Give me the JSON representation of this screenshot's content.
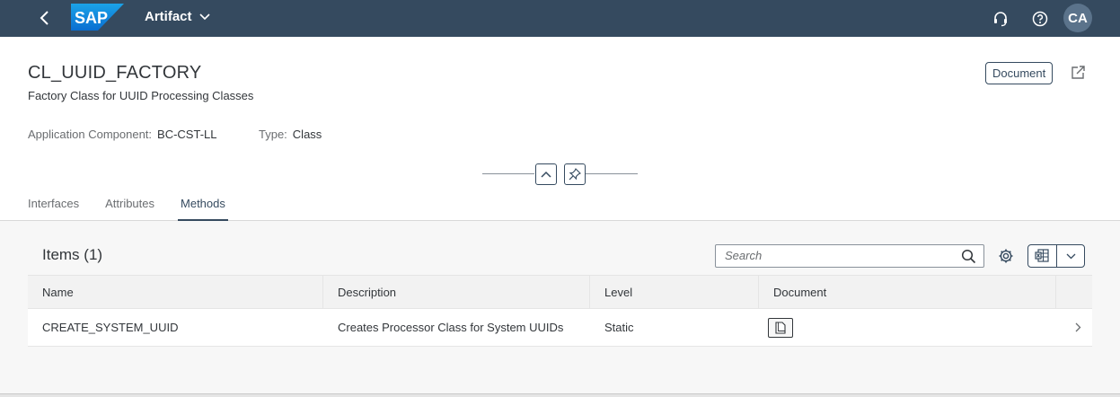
{
  "shell": {
    "logo_text": "SAP",
    "app_title": "Artifact",
    "avatar_initials": "CA",
    "colors": {
      "shell_bg": "#354a5f",
      "logo_blue": "#0a6ed1"
    }
  },
  "header": {
    "title": "CL_UUID_FACTORY",
    "subtitle": "Factory Class for UUID Processing Classes",
    "document_button": "Document",
    "attributes": {
      "component_label": "Application Component:",
      "component_value": "BC-CST-LL",
      "type_label": "Type:",
      "type_value": "Class"
    }
  },
  "tabs": [
    {
      "label": "Interfaces",
      "selected": false
    },
    {
      "label": "Attributes",
      "selected": false
    },
    {
      "label": "Methods",
      "selected": true
    }
  ],
  "items": {
    "title": "Items (1)",
    "search_placeholder": "Search",
    "columns": [
      "Name",
      "Description",
      "Level",
      "Document"
    ],
    "rows": [
      {
        "name": "CREATE_SYSTEM_UUID",
        "description": "Creates Processor Class for System UUIDs",
        "level": "Static",
        "document_icon": "document-icon"
      }
    ]
  }
}
